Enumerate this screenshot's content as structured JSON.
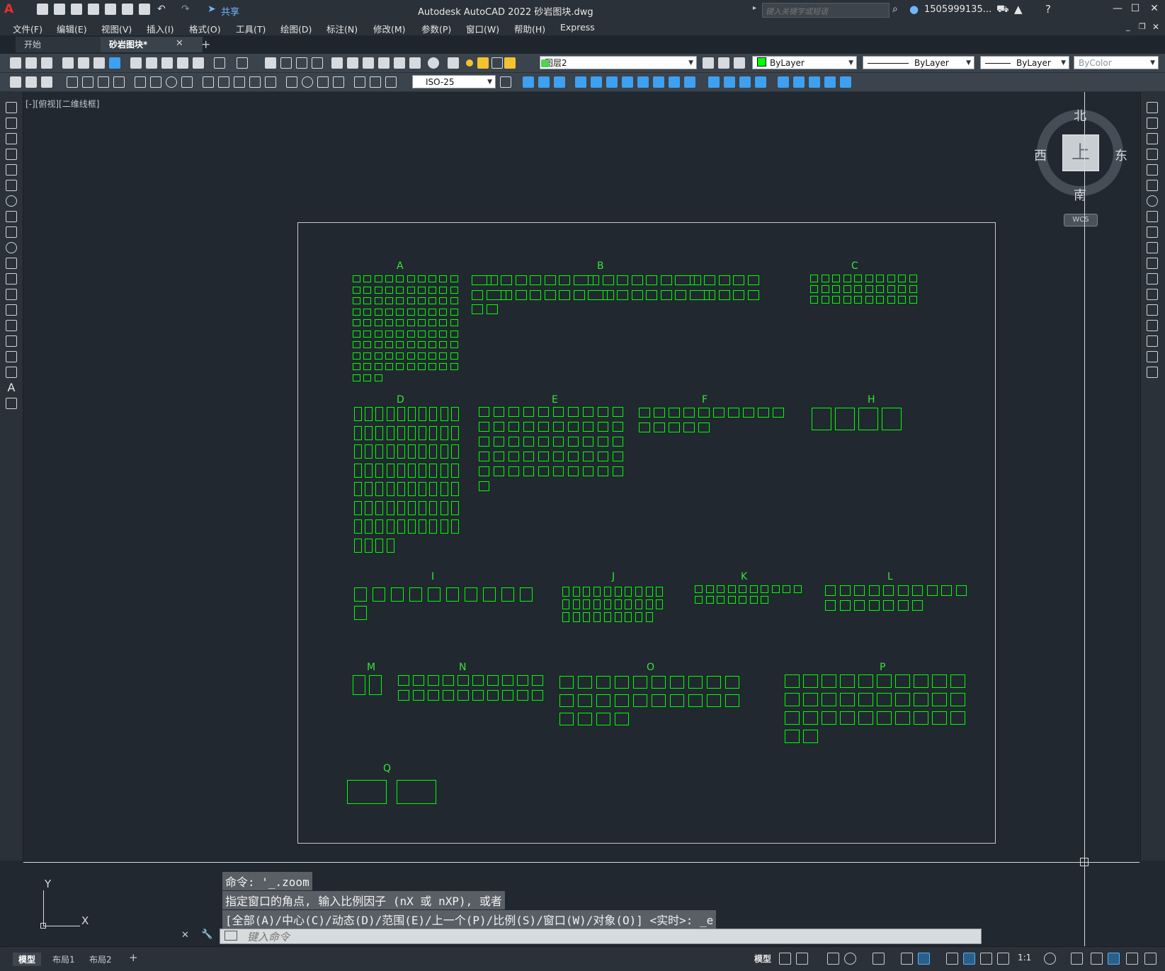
{
  "titlebar": {
    "logo": "A",
    "share": "共享",
    "title": "Autodesk AutoCAD 2022    砂岩图块.dwg",
    "search_placeholder": "键入关键字或短语",
    "user": "1505999135...",
    "minimize": "—",
    "maximize": "☐",
    "close": "✕"
  },
  "menu": [
    "文件(F)",
    "编辑(E)",
    "视图(V)",
    "插入(I)",
    "格式(O)",
    "工具(T)",
    "绘图(D)",
    "标注(N)",
    "修改(M)",
    "参数(P)",
    "窗口(W)",
    "帮助(H)",
    "Express"
  ],
  "tabs": {
    "start": "开始",
    "doc": "砂岩图块*",
    "close": "✕",
    "add": "+"
  },
  "toolbar": {
    "layer": "图层2",
    "color": "ByLayer",
    "linetype": "ByLayer",
    "lineweight": "ByLayer",
    "plotstyle": "ByColor",
    "dimstyle": "ISO-25"
  },
  "viewport": {
    "label": "[-][俯视][二维线框]"
  },
  "viewcube": {
    "north": "北",
    "south": "南",
    "east": "东",
    "west": "西",
    "face": "上",
    "wcs": "WCS"
  },
  "groups": [
    {
      "label": "A"
    },
    {
      "label": "B"
    },
    {
      "label": "C"
    },
    {
      "label": "D"
    },
    {
      "label": "E"
    },
    {
      "label": "F"
    },
    {
      "label": "H"
    },
    {
      "label": "I"
    },
    {
      "label": "J"
    },
    {
      "label": "K"
    },
    {
      "label": "L"
    },
    {
      "label": "M"
    },
    {
      "label": "N"
    },
    {
      "label": "O"
    },
    {
      "label": "P"
    },
    {
      "label": "Q"
    }
  ],
  "command": {
    "line1": "命令: '_.zoom",
    "line2": "指定窗口的角点, 输入比例因子 (nX 或 nXP), 或者",
    "line3": "[全部(A)/中心(C)/动态(D)/范围(E)/上一个(P)/比例(S)/窗口(W)/对象(O)] <实时>: _e",
    "placeholder": "键入命令"
  },
  "ucs": {
    "x": "X",
    "y": "Y"
  },
  "status": {
    "layout_tabs": [
      "模型",
      "布局1",
      "布局2"
    ],
    "add": "+",
    "model": "模型",
    "scale": "1:1"
  },
  "colors": {
    "block_green": "#00ff00",
    "canvas_bg": "#212830",
    "logo_red": "#e5312f"
  }
}
